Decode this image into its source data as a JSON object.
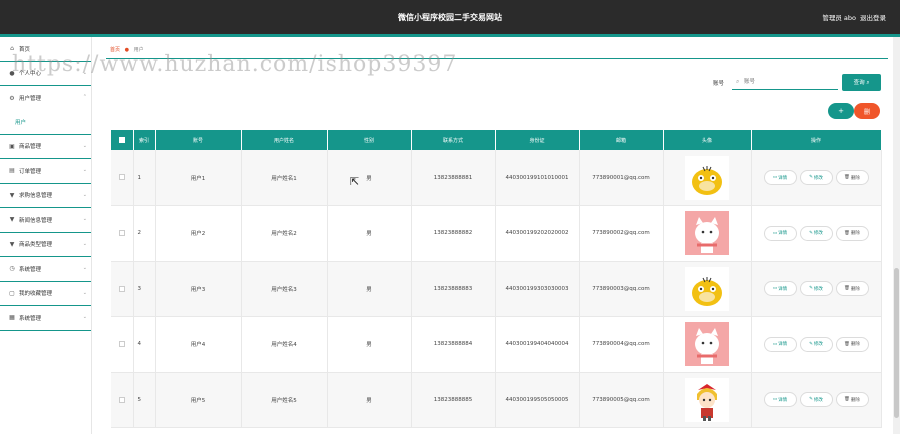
{
  "topbar": {
    "title": "微信小程序校园二手交易网站",
    "user": "管理员 abo",
    "logout": "退出登录"
  },
  "sidebar": {
    "items": [
      {
        "label": "首页",
        "icon": "home-icon"
      },
      {
        "label": "个人中心",
        "icon": "user-icon"
      },
      {
        "label": "用户管理",
        "icon": "gear-icon"
      },
      {
        "label": "商品管理",
        "icon": "box-icon"
      },
      {
        "label": "订单管理",
        "icon": "order-icon"
      },
      {
        "label": "求购信息管理",
        "icon": "filter-icon"
      },
      {
        "label": "新闻信息管理",
        "icon": "filter-icon"
      },
      {
        "label": "商品类型管理",
        "icon": "filter-icon"
      },
      {
        "label": "系统管理",
        "icon": "clock-icon"
      },
      {
        "label": "我的收藏管理",
        "icon": "bookmark-icon"
      },
      {
        "label": "系统管理",
        "icon": "settings-icon"
      }
    ],
    "sub_item": "用户"
  },
  "breadcrumb": {
    "home": "首页",
    "current": "用户"
  },
  "search": {
    "label": "账号",
    "placeholder": "账号",
    "button": "查询"
  },
  "actions": {
    "add": "+",
    "delete": "删"
  },
  "table": {
    "headers": [
      "",
      "索引",
      "账号",
      "用户姓名",
      "性别",
      "联系方式",
      "身份证",
      "邮箱",
      "头像",
      "操作"
    ],
    "op_labels": {
      "detail": "详情",
      "edit": "修改",
      "delete": "删除"
    },
    "rows": [
      {
        "index": "1",
        "account": "用户1",
        "name": "用户姓名1",
        "gender": "男",
        "phone": "13823888881",
        "idcard": "440300199101010001",
        "email": "773890001@qq.com",
        "avatar": "yellow-duck"
      },
      {
        "index": "2",
        "account": "用户2",
        "name": "用户姓名2",
        "gender": "男",
        "phone": "13823888882",
        "idcard": "440300199202020002",
        "email": "773890002@qq.com",
        "avatar": "pink-cat"
      },
      {
        "index": "3",
        "account": "用户3",
        "name": "用户姓名3",
        "gender": "男",
        "phone": "13823888883",
        "idcard": "440300199303030003",
        "email": "773890003@qq.com",
        "avatar": "yellow-duck"
      },
      {
        "index": "4",
        "account": "用户4",
        "name": "用户姓名4",
        "gender": "男",
        "phone": "13823888884",
        "idcard": "440300199404040004",
        "email": "773890004@qq.com",
        "avatar": "pink-cat"
      },
      {
        "index": "5",
        "account": "用户5",
        "name": "用户姓名5",
        "gender": "男",
        "phone": "13823888885",
        "idcard": "440300199505050005",
        "email": "773890005@qq.com",
        "avatar": "anime-girl"
      }
    ]
  },
  "watermark": "https://www.huzhan.com/ishop39397",
  "colors": {
    "accent": "#15968b",
    "danger": "#f0562a",
    "topbar": "#2b2b2b"
  }
}
